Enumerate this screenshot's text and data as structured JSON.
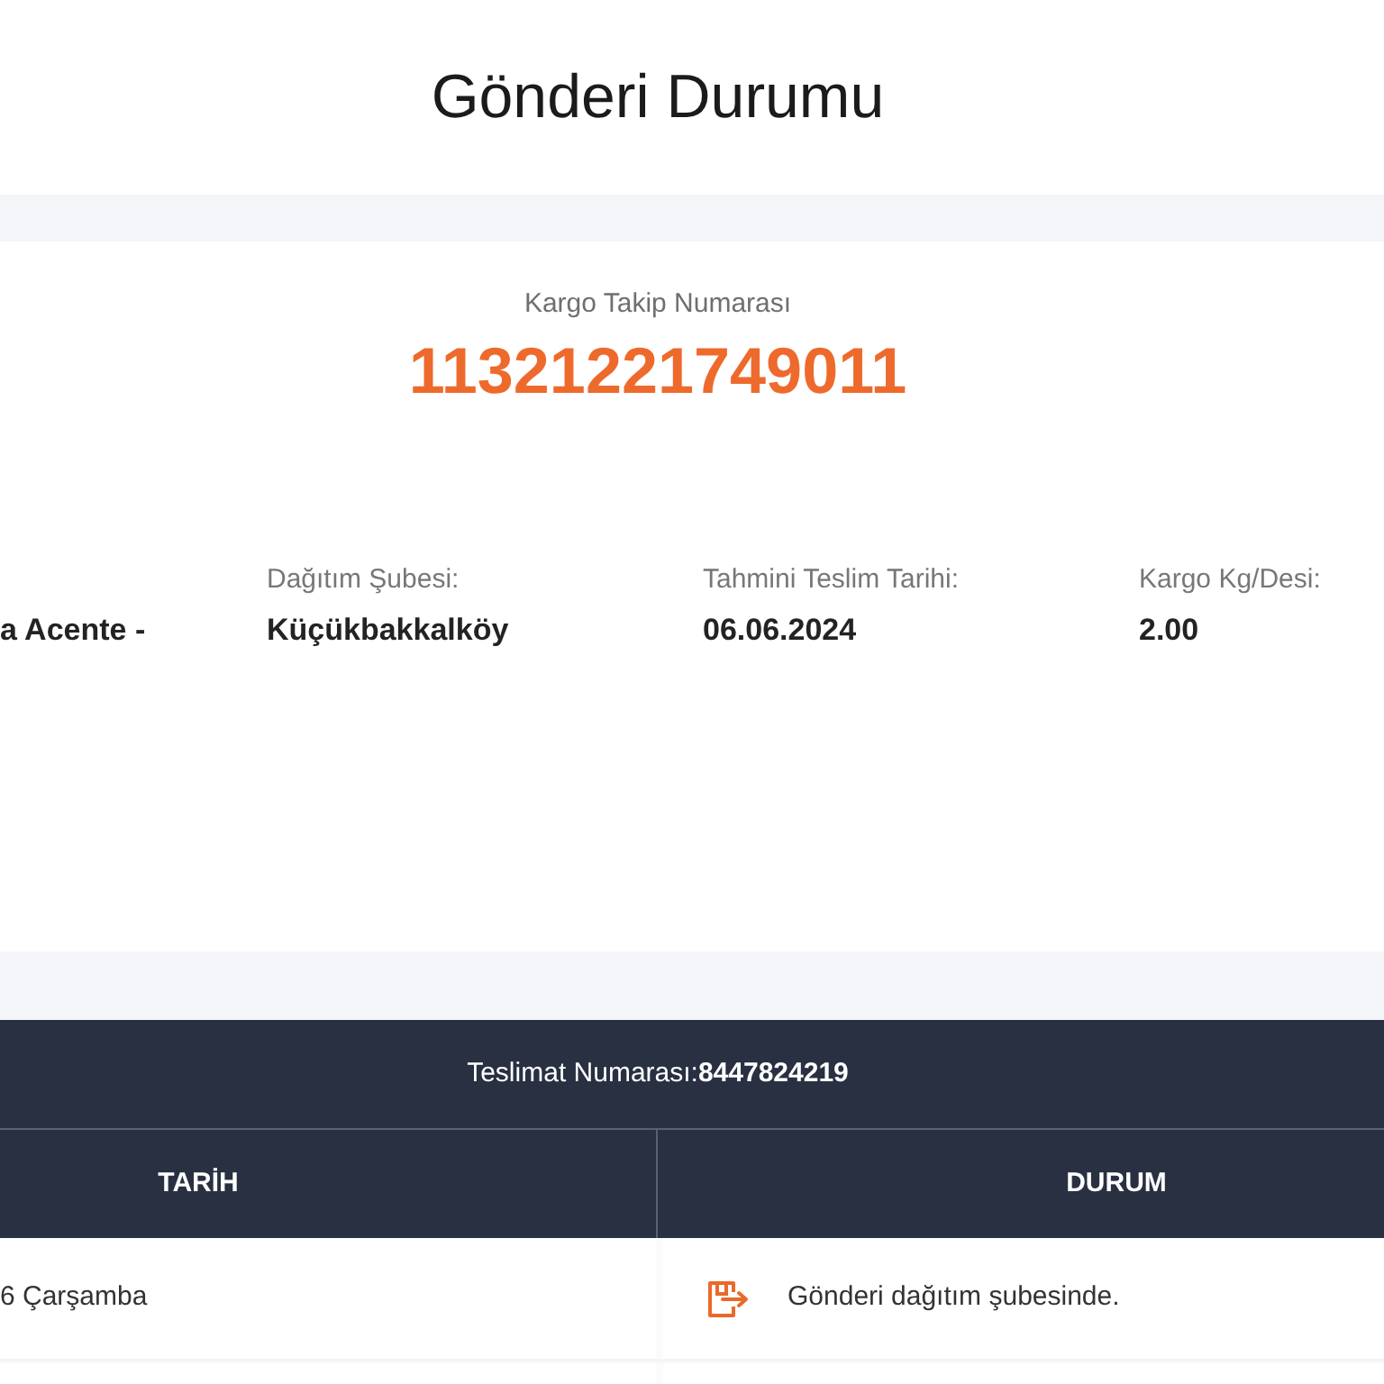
{
  "page_title": "Gönderi Durumu",
  "tracking": {
    "label": "Kargo Takip Numarası",
    "number": "11321221749011"
  },
  "details": [
    {
      "value": "a Acente -"
    },
    {
      "label": "Dağıtım Şubesi:",
      "value": "Küçükbakkalköy"
    },
    {
      "label": "Tahmini Teslim Tarihi:",
      "value": "06.06.2024"
    },
    {
      "label": "Kargo Kg/Desi:",
      "value": "2.00"
    }
  ],
  "delivery": {
    "text": "Teslimat Numarası:**8447824219**"
  },
  "table": {
    "columns": [
      "TARİH",
      "DURUM"
    ],
    "rows": [
      {
        "date": "6 Çarşamba",
        "status": "Gönderi dağıtım şubesinde."
      }
    ]
  }
}
